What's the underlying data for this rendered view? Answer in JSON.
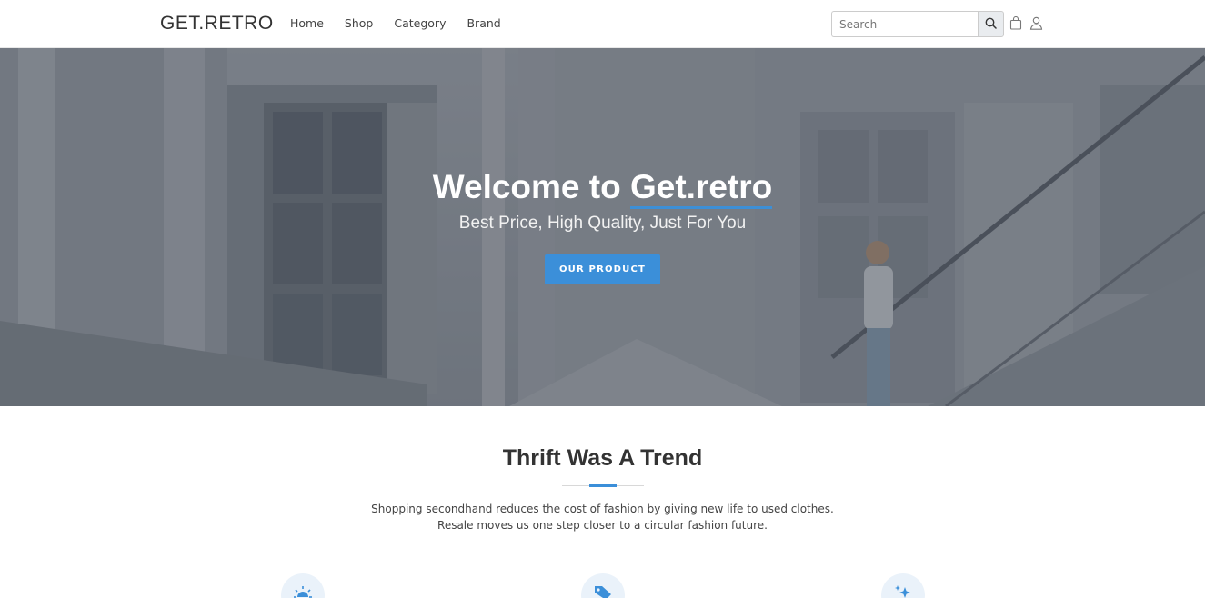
{
  "navbar": {
    "brand": "GET.RETRO",
    "links": [
      "Home",
      "Shop",
      "Category",
      "Brand"
    ],
    "search_placeholder": "Search",
    "icons": [
      "search-icon",
      "shopping-bag-icon",
      "user-icon"
    ]
  },
  "hero": {
    "title_prefix": "Welcome to ",
    "title_accent": "Get.retro",
    "subtitle": "Best Price, High Quality, Just For You",
    "button_label": "OUR PRODUCT"
  },
  "about": {
    "title": "Thrift Was A Trend",
    "line1": "Shopping secondhand reduces the cost of fashion by giving new life to used clothes.",
    "line2": "Resale moves us one step closer to a circular fashion future."
  },
  "features": {
    "icons": [
      "sun-icon",
      "price-tag-icon",
      "sparkles-icon"
    ]
  },
  "colors": {
    "accent": "#3b8fd9",
    "text": "#333333",
    "hero_overlay": "#464c58"
  }
}
